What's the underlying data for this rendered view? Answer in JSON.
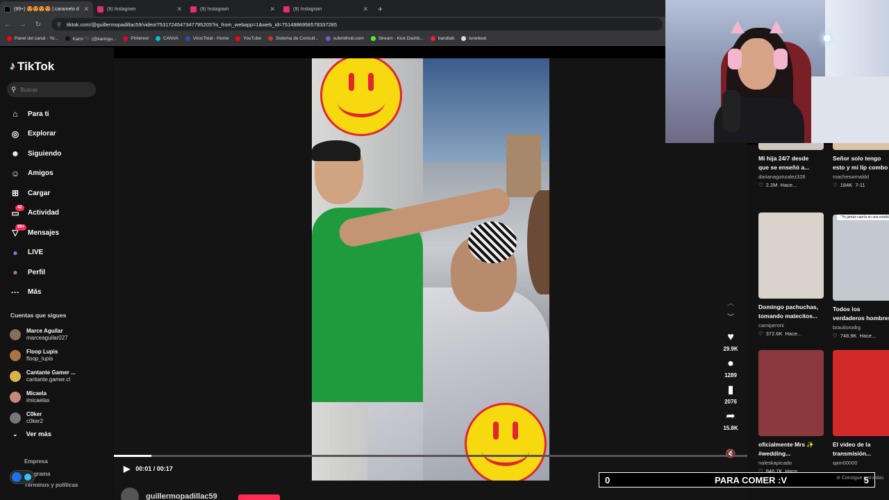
{
  "browser": {
    "tabs": [
      {
        "title": "(99+) 😍😍😍😍 | caramelo d",
        "active": true,
        "color": "#111111"
      },
      {
        "title": "(9) Instagram",
        "active": false,
        "color": "#e1306c"
      },
      {
        "title": "(9) Instagram",
        "active": false,
        "color": "#e1306c"
      },
      {
        "title": "(9) Instagram",
        "active": false,
        "color": "#e1306c"
      }
    ],
    "url": "tiktok.com/@guillermopadillac59/video/7531724547347795205?is_from_webapp=1&web_id=7514886958578337285",
    "bookmarks": [
      {
        "label": "Panel del canal - Yo...",
        "color": "#ff0000"
      },
      {
        "label": "Karin 🖤 (@karingu...",
        "color": "#111111"
      },
      {
        "label": "Pinterest",
        "color": "#e60023"
      },
      {
        "label": "CANVA",
        "color": "#00c4cc"
      },
      {
        "label": "VirusTotal - Home",
        "color": "#3949ab"
      },
      {
        "label": "YouTube",
        "color": "#ff0000"
      },
      {
        "label": "Sistema de Consult...",
        "color": "#c0392b"
      },
      {
        "label": "submithub.com",
        "color": "#7e57c2"
      },
      {
        "label": "Stream - Kick Dashb...",
        "color": "#53fc18"
      },
      {
        "label": "bandlab",
        "color": "#f5222d"
      },
      {
        "label": "tunebeat",
        "color": "#dddddd"
      }
    ]
  },
  "sidebar": {
    "logo": "TikTok",
    "search_placeholder": "Buscar",
    "menu": [
      {
        "label": "Para ti",
        "icon": "home-icon",
        "glyph": "⌂"
      },
      {
        "label": "Explorar",
        "icon": "compass-icon",
        "glyph": "◎"
      },
      {
        "label": "Siguiendo",
        "icon": "following-icon",
        "glyph": "☻"
      },
      {
        "label": "Amigos",
        "icon": "friends-icon",
        "glyph": "☺"
      },
      {
        "label": "Cargar",
        "icon": "upload-icon",
        "glyph": "⊞"
      },
      {
        "label": "Actividad",
        "icon": "activity-icon",
        "glyph": "▭",
        "badge": "42"
      },
      {
        "label": "Mensajes",
        "icon": "messages-icon",
        "glyph": "▽",
        "badge": "99+"
      },
      {
        "label": "LIVE",
        "icon": "live-icon",
        "glyph": "●"
      },
      {
        "label": "Perfil",
        "icon": "profile-icon",
        "glyph": "●"
      },
      {
        "label": "Más",
        "icon": "more-icon",
        "glyph": "···"
      }
    ],
    "following_title": "Cuentas que sigues",
    "following": [
      {
        "name": "Marce Aguilar",
        "handle": "marceaguilar027",
        "color": "#8a6d5a"
      },
      {
        "name": "Floop Lupis",
        "handle": "floop_lupis",
        "color": "#a8743f"
      },
      {
        "name": "Cantante Gamer ...",
        "handle": "cantante.gamer.cl",
        "color": "#d9b24a"
      },
      {
        "name": "Micaela",
        "handle": "imicaelax",
        "color": "#c7877a"
      },
      {
        "name": "C0ker",
        "handle": "c0ker2",
        "color": "#777777"
      }
    ],
    "see_more": "Ver más",
    "footer": [
      "Empresa",
      "Programa",
      "Términos y políticas"
    ]
  },
  "player": {
    "progress": 0.059,
    "time": "00:01 / 00:17",
    "username": "guillermopadillac59"
  },
  "actions": {
    "likes": "29.9K",
    "comments": "1289",
    "saves": "2076",
    "shares": "15.8K"
  },
  "recommended": [
    {
      "title": "Mi hija 24/7 desde",
      "title2": "que se enseñó a...",
      "author": "darianagonzalez328",
      "views": "2.2M",
      "when": "Hace...",
      "thumb": "#cfc7bd"
    },
    {
      "title": "Señor solo tengo",
      "title2": "esto y mi lip combo",
      "author": "macheswmaldd",
      "views": "184K",
      "when": "7-11",
      "thumb": "#d8c4a6"
    },
    {
      "title": "Domingo pachuchas,",
      "title2": "tomando matecitos...",
      "author": "camiperoni",
      "views": "372.6K",
      "when": "Hace...",
      "thumb": "#d9d3cc"
    },
    {
      "title": "Todos los",
      "title2": "verdaderos hombres",
      "author": "brauliorodrg",
      "views": "748.9K",
      "when": "Hace...",
      "thumb": "#c4c8cf",
      "thumb_text": "\"Yo jamás caería en una estafa\""
    },
    {
      "title": "oficialmente Mrs ✨",
      "title2": "#wedding...",
      "author": "naleskapicado",
      "views": "846.7K",
      "when": "Hace...",
      "thumb": "#8a3a3e"
    },
    {
      "title": "El video de la",
      "title2": "transmisión...",
      "author": "qam00000",
      "views": "",
      "when": "",
      "thumb": "#d12a28"
    }
  ],
  "overlay": {
    "left": "0",
    "center": "PARA COMER :V",
    "right": "5",
    "goal_label": "Consigue monedas"
  }
}
